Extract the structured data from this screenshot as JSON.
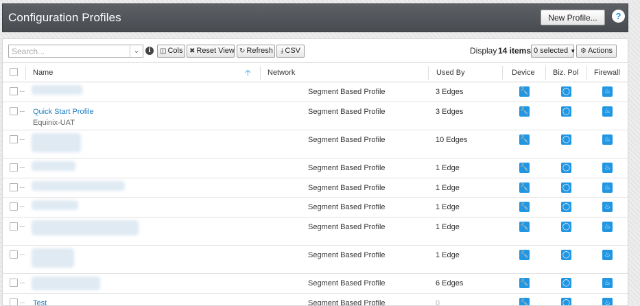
{
  "header": {
    "title": "Configuration Profiles",
    "new_profile_label": "New Profile...",
    "help_label": "?"
  },
  "toolbar": {
    "search_placeholder": "Search...",
    "cols_label": "Cols",
    "reset_view_label": "Reset View",
    "refresh_label": "Refresh",
    "csv_label": "CSV",
    "display_label": "Display",
    "display_count": "14 items.",
    "selected_label": "0 selected",
    "actions_label": "Actions"
  },
  "columns": {
    "name": "Name",
    "network": "Network",
    "used_by": "Used By",
    "device": "Device",
    "biz_pol": "Biz. Pol",
    "firewall": "Firewall"
  },
  "rows": [
    {
      "name": "",
      "subtitle": "",
      "network": "Segment Based Profile",
      "used_by": "3 Edges"
    },
    {
      "name": "Quick Start Profile",
      "subtitle": "Equinix-UAT",
      "network": "Segment Based Profile",
      "used_by": "3 Edges"
    },
    {
      "name": "",
      "subtitle": "",
      "network": "Segment Based Profile",
      "used_by": "10 Edges"
    },
    {
      "name": "",
      "subtitle": "",
      "network": "Segment Based Profile",
      "used_by": "1 Edge"
    },
    {
      "name": "",
      "subtitle": "",
      "network": "Segment Based Profile",
      "used_by": "1 Edge"
    },
    {
      "name": "",
      "subtitle": "",
      "network": "Segment Based Profile",
      "used_by": "1 Edge"
    },
    {
      "name": "",
      "subtitle": "",
      "network": "Segment Based Profile",
      "used_by": "1 Edge"
    },
    {
      "name": "",
      "subtitle": "",
      "network": "Segment Based Profile",
      "used_by": "1 Edge"
    },
    {
      "name": "",
      "subtitle": "",
      "network": "Segment Based Profile",
      "used_by": "6 Edges"
    },
    {
      "name": "Test",
      "subtitle": "",
      "network": "Segment Based Profile",
      "used_by": "0"
    }
  ],
  "icons": {
    "device": "wrench-icon",
    "biz_pol": "badge-icon",
    "firewall": "flame-icon"
  },
  "colors": {
    "accent": "#2196e3",
    "link": "#1f7fc4",
    "header_bg": "#53575c"
  }
}
